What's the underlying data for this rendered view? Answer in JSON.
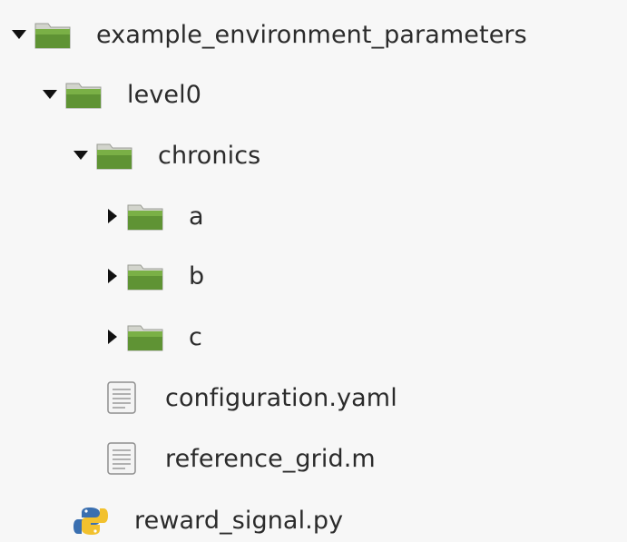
{
  "tree": {
    "root": {
      "label": "example_environment_parameters",
      "expanded": true,
      "icon": "folder-icon"
    },
    "level0": {
      "label": "level0",
      "expanded": true,
      "icon": "folder-icon"
    },
    "chronics": {
      "label": "chronics",
      "expanded": true,
      "icon": "folder-icon"
    },
    "a": {
      "label": "a",
      "expanded": false,
      "icon": "folder-icon"
    },
    "b": {
      "label": "b",
      "expanded": false,
      "icon": "folder-icon"
    },
    "c": {
      "label": "c",
      "expanded": false,
      "icon": "folder-icon"
    },
    "configuration": {
      "label": "configuration.yaml",
      "icon": "text-file-icon"
    },
    "reference_grid": {
      "label": "reference_grid.m",
      "icon": "text-file-icon"
    },
    "reward_signal": {
      "label": "reward_signal.py",
      "icon": "python-file-icon"
    }
  },
  "colors": {
    "background": "#f7f7f7",
    "folder_green": "#6a9a3a",
    "folder_light": "#d7d9d0",
    "text": "#2b2b2b"
  }
}
